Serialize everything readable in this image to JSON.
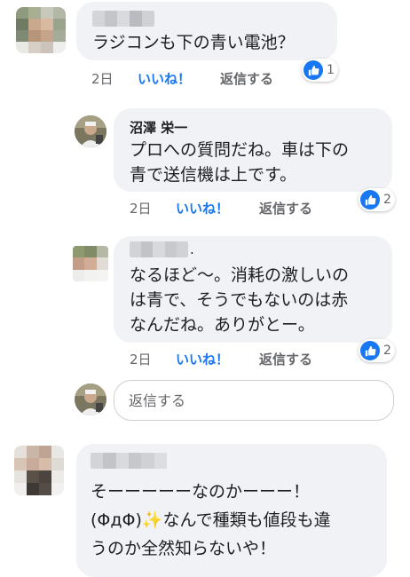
{
  "comments": [
    {
      "author": "",
      "text_lines": [
        "ラジコンも下の青い電池？"
      ],
      "age": "2日",
      "like_label": "いいね！",
      "reply_label": "返信する",
      "reaction_count": "1"
    }
  ],
  "replies": [
    {
      "author": "沼澤 栄一",
      "text_lines": [
        "プロへの質問だね。車は下の",
        "青で送信機は上です。"
      ],
      "age": "2日",
      "like_label": "いいね！",
      "reply_label": "返信する",
      "reaction_count": "2"
    },
    {
      "author": "",
      "author_suffix": ".",
      "text_lines": [
        "なるほど〜。消耗の激しいの",
        "は青で、そうでもないのは赤",
        "なんだね。ありがとー。"
      ],
      "age": "2日",
      "like_label": "いいね！",
      "reply_label": "返信する",
      "reaction_count": "2"
    }
  ],
  "reply_input": {
    "placeholder": "返信する"
  },
  "bottom_comment": {
    "author": "",
    "text_lines": [
      "そーーーーーなのかーーー！",
      "(ΦдΦ)✨なんで種類も値段も違",
      "うのか全然知らないや！"
    ]
  },
  "colors": {
    "bubble": "#f0f2f5",
    "like_blue": "#1877f2",
    "meta_gray": "#65676b",
    "text": "#1c1e21"
  },
  "icons": {
    "reaction": "thumbs-up-icon",
    "sparkle": "sparkles-emoji"
  }
}
